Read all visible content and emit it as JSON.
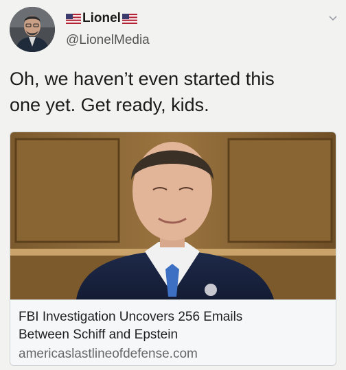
{
  "user": {
    "display_name": "Lionel",
    "handle": "@LionelMedia"
  },
  "tweet": {
    "text_line1": "Oh, we haven’t even started this",
    "text_line2": "one yet. Get ready, kids."
  },
  "card": {
    "title_line1": "FBI Investigation Uncovers 256 Emails",
    "title_line2": "Between Schiff and Epstein",
    "domain": "americaslastlineofdefense.com"
  },
  "icons": {
    "flag": "us-flag-icon",
    "menu": "chevron-down-icon"
  }
}
